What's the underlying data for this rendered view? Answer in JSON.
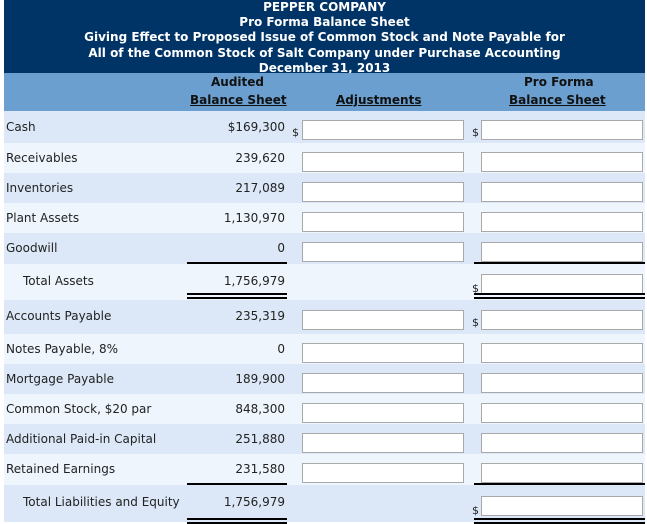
{
  "header": {
    "lines": [
      "PEPPER COMPANY",
      "Pro Forma Balance Sheet",
      "Giving Effect to Proposed Issue of Common Stock and Note Payable for",
      "All of the Common Stock of Salt Company under Purchase Accounting",
      "December 31, 2013"
    ]
  },
  "columns": {
    "audited_top": "Audited",
    "audited_bottom": "Balance Sheet",
    "adjustments": "Adjustments",
    "proforma_top": "Pro Forma",
    "proforma_bottom": "Balance Sheet"
  },
  "currency_symbol": "$",
  "rows": [
    {
      "label": "Cash",
      "audited": "$169,300",
      "adjustment": "",
      "pro_forma": ""
    },
    {
      "label": "Receivables",
      "audited": "239,620",
      "adjustment": "",
      "pro_forma": ""
    },
    {
      "label": "Inventories",
      "audited": "217,089",
      "adjustment": "",
      "pro_forma": ""
    },
    {
      "label": "Plant Assets",
      "audited": "1,130,970",
      "adjustment": "",
      "pro_forma": ""
    },
    {
      "label": "Goodwill",
      "audited": "0",
      "adjustment": "",
      "pro_forma": ""
    },
    {
      "label": "Total Assets",
      "audited": "1,756,979",
      "pro_forma": ""
    },
    {
      "label": "Accounts Payable",
      "audited": "235,319",
      "adjustment": "",
      "pro_forma": ""
    },
    {
      "label": "Notes Payable, 8%",
      "audited": "0",
      "adjustment": "",
      "pro_forma": ""
    },
    {
      "label": "Mortgage Payable",
      "audited": "189,900",
      "adjustment": "",
      "pro_forma": ""
    },
    {
      "label": "Common Stock, $20 par",
      "audited": "848,300",
      "adjustment": "",
      "pro_forma": ""
    },
    {
      "label": "Additional Paid-in Capital",
      "audited": "251,880",
      "adjustment": "",
      "pro_forma": ""
    },
    {
      "label": "Retained Earnings",
      "audited": "231,580",
      "adjustment": "",
      "pro_forma": ""
    },
    {
      "label": "Total Liabilities and Equity",
      "audited": "1,756,979",
      "pro_forma": ""
    }
  ]
}
